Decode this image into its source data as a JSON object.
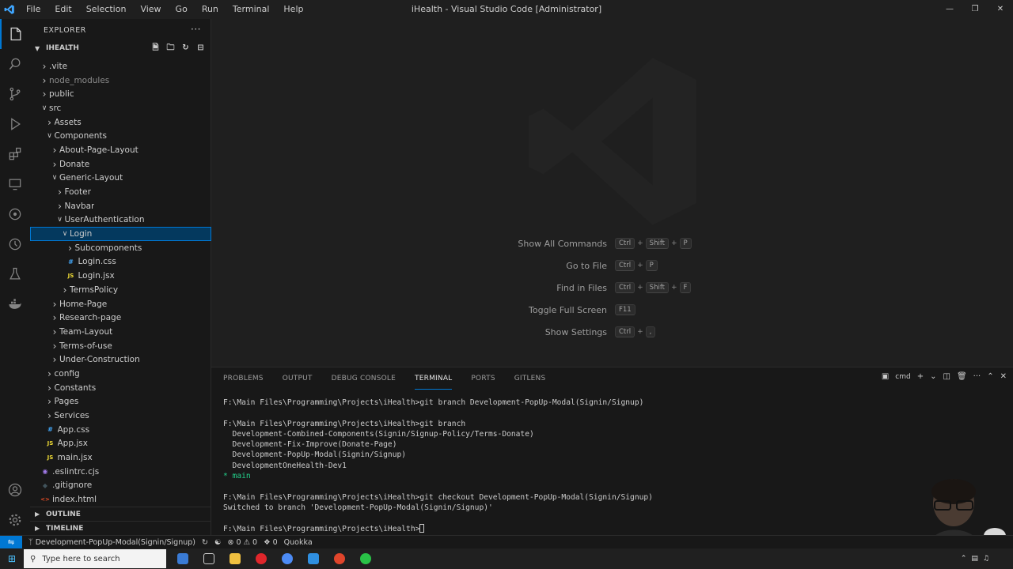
{
  "titlebar": {
    "title": "iHealth - Visual Studio Code [Administrator]",
    "menu": [
      "File",
      "Edit",
      "Selection",
      "View",
      "Go",
      "Run",
      "Terminal",
      "Help"
    ]
  },
  "sidebar": {
    "header": "EXPLORER",
    "root": "IHEALTH",
    "outline": "OUTLINE",
    "timeline": "TIMELINE",
    "tree": [
      {
        "label": ".vite",
        "depth": 0,
        "type": "folder",
        "open": false,
        "dim": false
      },
      {
        "label": "node_modules",
        "depth": 0,
        "type": "folder",
        "open": false,
        "dim": true
      },
      {
        "label": "public",
        "depth": 0,
        "type": "folder",
        "open": false,
        "dim": false
      },
      {
        "label": "src",
        "depth": 0,
        "type": "folder",
        "open": true,
        "dim": false
      },
      {
        "label": "Assets",
        "depth": 1,
        "type": "folder",
        "open": false,
        "dim": false
      },
      {
        "label": "Components",
        "depth": 1,
        "type": "folder",
        "open": true,
        "dim": false
      },
      {
        "label": "About-Page-Layout",
        "depth": 2,
        "type": "folder",
        "open": false,
        "dim": false
      },
      {
        "label": "Donate",
        "depth": 2,
        "type": "folder",
        "open": false,
        "dim": false
      },
      {
        "label": "Generic-Layout",
        "depth": 2,
        "type": "folder",
        "open": true,
        "dim": false
      },
      {
        "label": "Footer",
        "depth": 3,
        "type": "folder",
        "open": false,
        "dim": false
      },
      {
        "label": "Navbar",
        "depth": 3,
        "type": "folder",
        "open": false,
        "dim": false
      },
      {
        "label": "UserAuthentication",
        "depth": 3,
        "type": "folder",
        "open": true,
        "dim": false
      },
      {
        "label": "Login",
        "depth": 4,
        "type": "folder",
        "open": true,
        "dim": false,
        "selected": true
      },
      {
        "label": "Subcomponents",
        "depth": 5,
        "type": "folder",
        "open": false,
        "dim": false
      },
      {
        "label": "Login.css",
        "depth": 5,
        "type": "css",
        "dim": false
      },
      {
        "label": "Login.jsx",
        "depth": 5,
        "type": "jsx",
        "dim": false
      },
      {
        "label": "TermsPolicy",
        "depth": 4,
        "type": "folder",
        "open": false,
        "dim": false
      },
      {
        "label": "Home-Page",
        "depth": 2,
        "type": "folder",
        "open": false,
        "dim": false
      },
      {
        "label": "Research-page",
        "depth": 2,
        "type": "folder",
        "open": false,
        "dim": false
      },
      {
        "label": "Team-Layout",
        "depth": 2,
        "type": "folder",
        "open": false,
        "dim": false
      },
      {
        "label": "Terms-of-use",
        "depth": 2,
        "type": "folder",
        "open": false,
        "dim": false
      },
      {
        "label": "Under-Construction",
        "depth": 2,
        "type": "folder",
        "open": false,
        "dim": false
      },
      {
        "label": "config",
        "depth": 1,
        "type": "folder",
        "open": false,
        "dim": false
      },
      {
        "label": "Constants",
        "depth": 1,
        "type": "folder",
        "open": false,
        "dim": false
      },
      {
        "label": "Pages",
        "depth": 1,
        "type": "folder",
        "open": false,
        "dim": false
      },
      {
        "label": "Services",
        "depth": 1,
        "type": "folder",
        "open": false,
        "dim": false
      },
      {
        "label": "App.css",
        "depth": 1,
        "type": "css",
        "dim": false
      },
      {
        "label": "App.jsx",
        "depth": 1,
        "type": "jsx",
        "dim": false
      },
      {
        "label": "main.jsx",
        "depth": 1,
        "type": "jsx",
        "dim": false
      },
      {
        "label": ".eslintrc.cjs",
        "depth": 0,
        "type": "eslint",
        "dim": false
      },
      {
        "label": ".gitignore",
        "depth": 0,
        "type": "git",
        "dim": false
      },
      {
        "label": "index.html",
        "depth": 0,
        "type": "html",
        "dim": false
      }
    ]
  },
  "editor": {
    "shortcuts": [
      {
        "name": "Show All Commands",
        "keys": [
          "Ctrl",
          "Shift",
          "P"
        ]
      },
      {
        "name": "Go to File",
        "keys": [
          "Ctrl",
          "P"
        ]
      },
      {
        "name": "Find in Files",
        "keys": [
          "Ctrl",
          "Shift",
          "F"
        ]
      },
      {
        "name": "Toggle Full Screen",
        "keys": [
          "F11"
        ]
      },
      {
        "name": "Show Settings",
        "keys": [
          "Ctrl",
          ","
        ]
      }
    ]
  },
  "panel": {
    "tabs": [
      "PROBLEMS",
      "OUTPUT",
      "DEBUG CONSOLE",
      "TERMINAL",
      "PORTS",
      "GITLENS"
    ],
    "active_tab": "TERMINAL",
    "shell": "cmd",
    "terminal_lines": [
      {
        "text": "F:\\Main Files\\Programming\\Projects\\iHealth>git branch Development-PopUp-Modal(Signin/Signup)",
        "cls": ""
      },
      {
        "text": "",
        "cls": ""
      },
      {
        "text": "F:\\Main Files\\Programming\\Projects\\iHealth>git branch",
        "cls": ""
      },
      {
        "text": "  Development-Combined-Components(Signin/Signup-Policy/Terms-Donate)",
        "cls": ""
      },
      {
        "text": "  Development-Fix-Improve(Donate-Page)",
        "cls": ""
      },
      {
        "text": "  Development-PopUp-Modal(Signin/Signup)",
        "cls": ""
      },
      {
        "text": "  DevelopmentOneHealth-Dev1",
        "cls": ""
      },
      {
        "text": "* main",
        "cls": "main"
      },
      {
        "text": "",
        "cls": ""
      },
      {
        "text": "F:\\Main Files\\Programming\\Projects\\iHealth>git checkout Development-PopUp-Modal(Signin/Signup)",
        "cls": ""
      },
      {
        "text": "Switched to branch 'Development-PopUp-Modal(Signin/Signup)'",
        "cls": ""
      },
      {
        "text": "",
        "cls": ""
      },
      {
        "text": "F:\\Main Files\\Programming\\Projects\\iHealth>",
        "cls": "prompt"
      }
    ]
  },
  "statusbar": {
    "branch": "Development-PopUp-Modal(Signin/Signup)",
    "errors": "0",
    "warnings": "0",
    "ports": "0",
    "quokka": "Quokka"
  },
  "taskbar": {
    "search_placeholder": "Type here to search"
  },
  "colors": {
    "accent": "#0078d4",
    "selection": "#04395e",
    "css_icon": "#42a5f5",
    "js_icon": "#f1dd35",
    "branch_main": "#23d18b"
  }
}
